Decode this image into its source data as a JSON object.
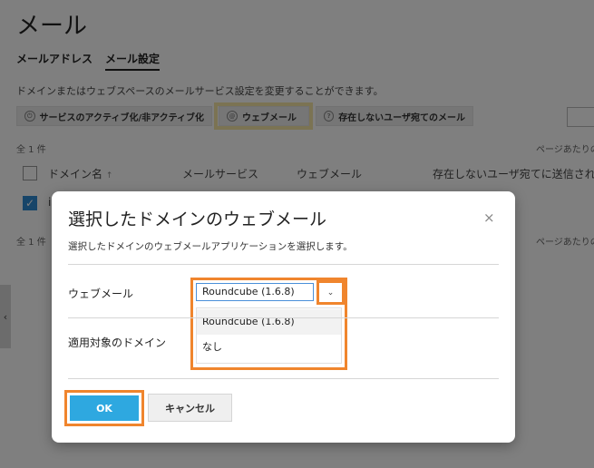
{
  "page": {
    "title": "メール",
    "tabs": [
      "メールアドレス",
      "メール設定"
    ],
    "description": "ドメインまたはウェブスペースのメールサービス設定を変更することができます。",
    "toolbar": [
      {
        "label": "サービスのアクティブ化/非アクティブ化",
        "icon": "power-icon"
      },
      {
        "label": "ウェブメール",
        "icon": "webmail-icon"
      },
      {
        "label": "存在しないユーザ宛てのメール",
        "icon": "question-icon"
      }
    ],
    "count_text": "全 1 件",
    "per_page_text": "ページあたりの",
    "table": {
      "headers": [
        "ドメイン名",
        "メールサービス",
        "ウェブメール",
        "存在しないユーザ宛てに送信された"
      ],
      "sort_indicator": "↑",
      "row_first_char": "i"
    },
    "count_text_bottom": "全 1 件",
    "per_page_text_bottom": "ページあたりの",
    "side_arrow": "‹"
  },
  "dialog": {
    "title": "選択したドメインのウェブメール",
    "close_glyph": "×",
    "subtitle": "選択したドメインのウェブメールアプリケーションを選択します。",
    "webmail_label": "ウェブメール",
    "domains_label": "適用対象のドメイン",
    "select_value": "Roundcube (1.6.8)",
    "select_arrow": "⌄",
    "options": [
      "Roundcube (1.6.8)",
      "なし"
    ],
    "ok_label": "OK",
    "cancel_label": "キャンセル"
  },
  "colors": {
    "accent_orange": "#f0852d",
    "ok_blue": "#2ea8e0",
    "checkbox_blue": "#2f8ad3",
    "highlight_yellow": "#f7e6a6"
  }
}
